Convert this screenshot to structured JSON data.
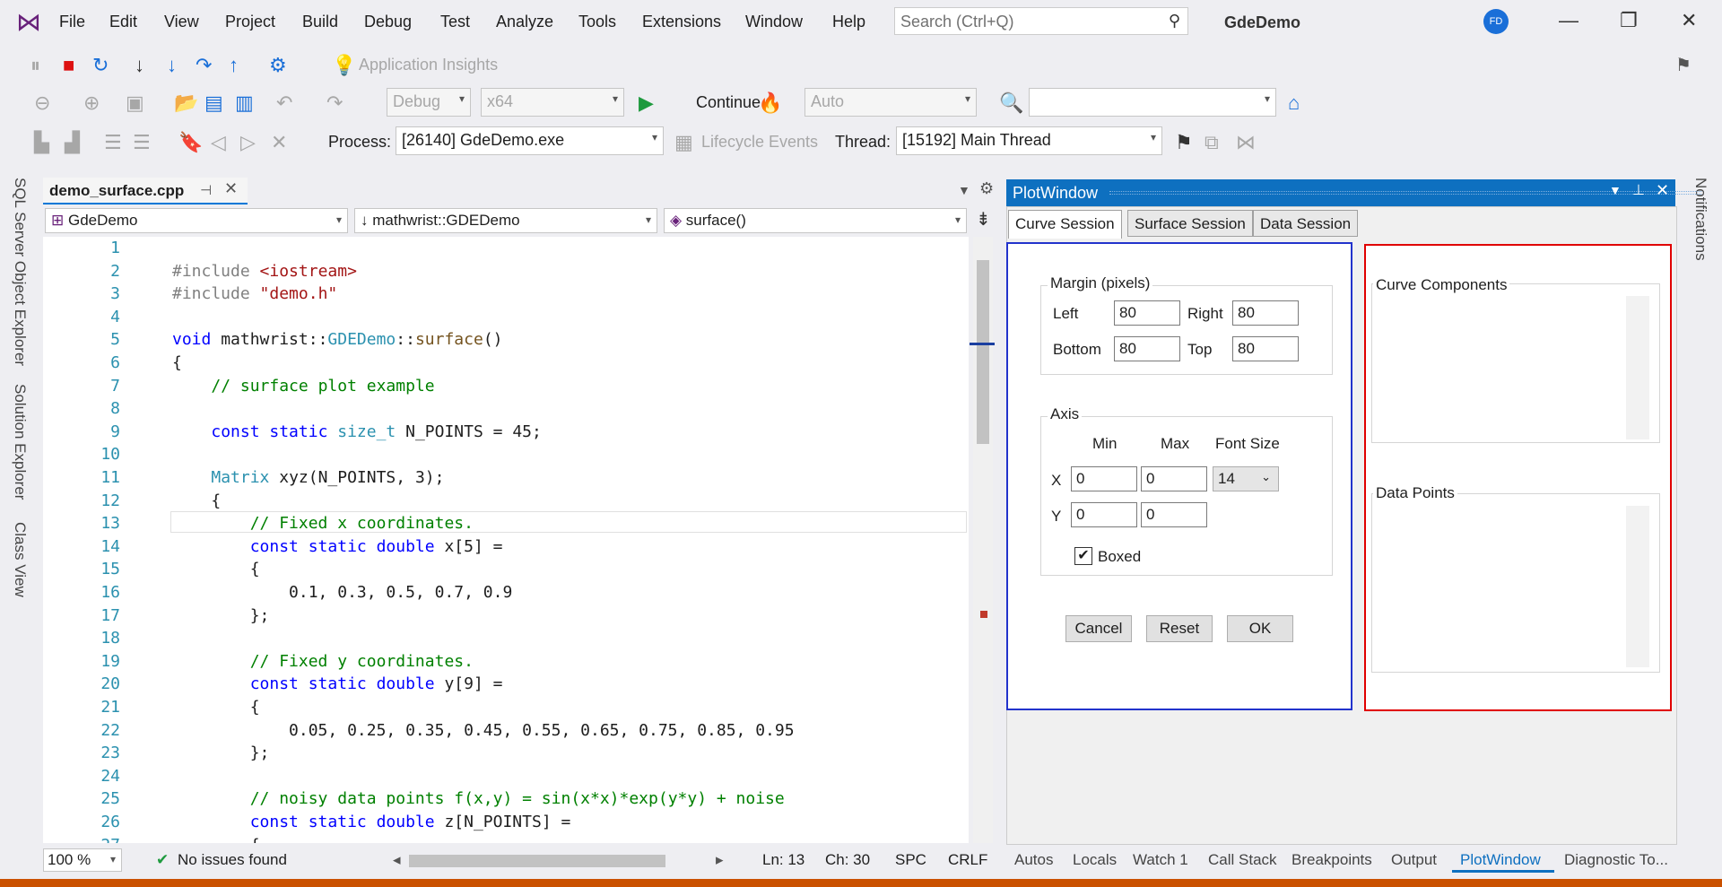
{
  "menu": [
    "File",
    "Edit",
    "View",
    "Project",
    "Build",
    "Debug",
    "Test",
    "Analyze",
    "Tools",
    "Extensions",
    "Window",
    "Help"
  ],
  "search": {
    "placeholder": "Search (Ctrl+Q)"
  },
  "app_title": "GdeDemo",
  "user_initials": "FD",
  "toolbar1": {
    "insights": "Application Insights"
  },
  "toolbar2": {
    "config": "Debug",
    "platform": "x64",
    "continue": "Continue",
    "auto": "Auto",
    "find_value": ""
  },
  "toolbar3": {
    "process_label": "Process:",
    "process": "[26140] GdeDemo.exe",
    "lifecycle": "Lifecycle Events",
    "thread_label": "Thread:",
    "thread": "[15192] Main Thread"
  },
  "left_tabs": [
    "SQL Server Object Explorer",
    "Solution Explorer",
    "Class View"
  ],
  "right_tabs": [
    "Notifications"
  ],
  "editor": {
    "tab": "demo_surface.cpp",
    "nav_project": "GdeDemo",
    "nav_scope": "mathwrist::GDEDemo",
    "nav_function": "surface()",
    "zoom": "100 %",
    "issues": "No issues found",
    "ln": "Ln: 13",
    "ch": "Ch: 30",
    "spc": "SPC",
    "crlf": "CRLF"
  },
  "plot_window": {
    "title": "PlotWindow",
    "tabs": [
      "Curve Session",
      "Surface Session",
      "Data Session"
    ],
    "margin": {
      "title": "Margin (pixels)",
      "left_label": "Left",
      "left": "80",
      "right_label": "Right",
      "right": "80",
      "bottom_label": "Bottom",
      "bottom": "80",
      "top_label": "Top",
      "top": "80"
    },
    "axis": {
      "title": "Axis",
      "min_label": "Min",
      "max_label": "Max",
      "font_label": "Font Size",
      "x_label": "X",
      "x_min": "0",
      "x_max": "0",
      "font_size": "14",
      "y_label": "Y",
      "y_min": "0",
      "y_max": "0",
      "boxed_label": "Boxed"
    },
    "buttons": {
      "cancel": "Cancel",
      "reset": "Reset",
      "ok": "OK"
    },
    "curve_components": "Curve Components",
    "data_points": "Data Points"
  },
  "bottom_tabs": [
    "Autos",
    "Locals",
    "Watch 1",
    "Call Stack",
    "Breakpoints",
    "Output",
    "PlotWindow",
    "Diagnostic To..."
  ]
}
